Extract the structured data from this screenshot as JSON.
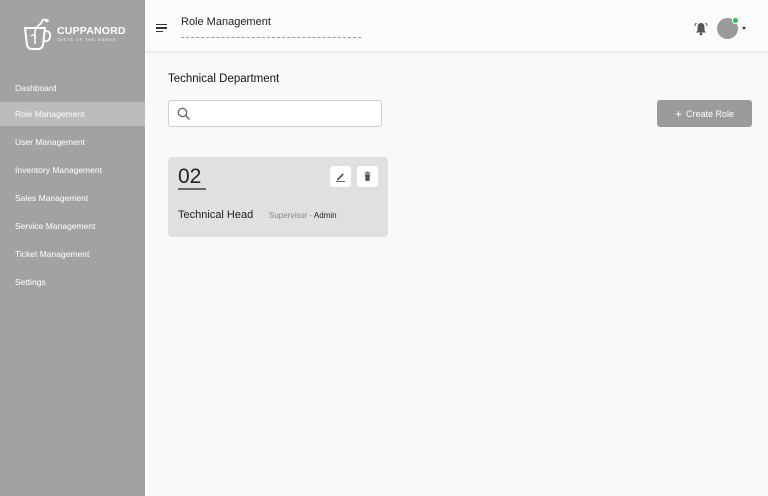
{
  "brand": {
    "name": "CUPPANORD",
    "tagline": "TASTE OF THE NORDS"
  },
  "sidebar": {
    "items": [
      {
        "label": "Dashboard"
      },
      {
        "label": "Role Management"
      },
      {
        "label": "User Management"
      },
      {
        "label": "Inventory Management"
      },
      {
        "label": "Sales Management"
      },
      {
        "label": "Service Management"
      },
      {
        "label": "Ticket Management"
      },
      {
        "label": "Settings"
      }
    ],
    "active_index": 1
  },
  "header": {
    "title": "Role Management",
    "menu_icon": "hamburger-menu-icon",
    "notification_icon": "bell-icon",
    "status_color": "#27c24c"
  },
  "main": {
    "department_title": "Technical Department",
    "search": {
      "placeholder": "",
      "value": ""
    },
    "create_button": {
      "label": "Create Role",
      "icon": "plus-icon"
    },
    "roles": [
      {
        "count": "02",
        "title": "Technical Head",
        "reports_to_label": "Supervisor",
        "separator": "-",
        "reports_to_value": "Admin"
      }
    ]
  },
  "colors": {
    "sidebar_bg": "#a2a2a2",
    "sidebar_active": "#bcbcbc",
    "card_bg": "#e0e0e0",
    "button_bg": "#9b9b9b"
  }
}
